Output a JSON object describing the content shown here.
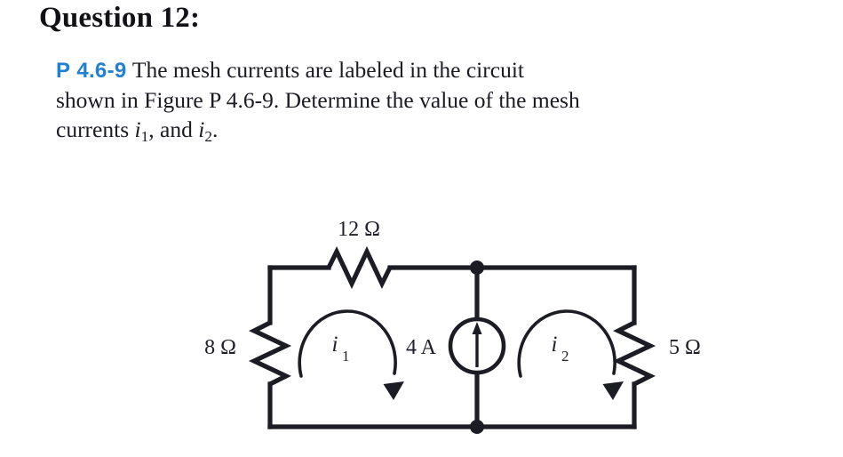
{
  "page": {
    "title": "Question 12:",
    "background_color": "#ffffff",
    "text_color": "#1b1b24"
  },
  "problem": {
    "id_prefix": "P",
    "id_number": "4.6-9",
    "id_color": "#1f81d0",
    "body_line1": "The mesh currents are labeled in the circuit",
    "body_line2": "shown in Figure P 4.6-9. Determine the value of the mesh",
    "body_line3_lead": "currents ",
    "body_line3_sym1": "i",
    "body_line3_sub1": "1",
    "body_line3_mid": ", and ",
    "body_line3_sym2": "i",
    "body_line3_sub2": "2",
    "body_line3_end": ".",
    "full_text": "P 4.6-9 The mesh currents are labeled in the circuit shown in Figure P 4.6-9. Determine the value of the mesh currents i1, and i2."
  },
  "circuit": {
    "caption_reference": "Figure P 4.6-9",
    "line_color": "#1c1c24",
    "components": [
      {
        "name": "resistor-12-ohm",
        "type": "resistor",
        "value": "12",
        "unit": "Ω",
        "label": "12 Ω",
        "orientation": "horizontal",
        "position": "top-branch"
      },
      {
        "name": "resistor-8-ohm",
        "type": "resistor",
        "value": "8",
        "unit": "Ω",
        "label": "8 Ω",
        "orientation": "vertical",
        "position": "left-branch"
      },
      {
        "name": "current-source-4a",
        "type": "current-source",
        "value": "4",
        "unit": "A",
        "label": "4 A",
        "direction": "up",
        "position": "center-branch"
      },
      {
        "name": "resistor-5-ohm",
        "type": "resistor",
        "value": "5",
        "unit": "Ω",
        "label": "5 Ω",
        "orientation": "vertical",
        "position": "right-branch"
      }
    ],
    "meshes": [
      {
        "name": "mesh-current-i1",
        "symbol": "i",
        "subscript": "1",
        "label": "i1",
        "direction": "clockwise",
        "position": "left-mesh"
      },
      {
        "name": "mesh-current-i2",
        "symbol": "i",
        "subscript": "2",
        "label": "i2",
        "direction": "clockwise",
        "position": "right-mesh"
      }
    ],
    "nodes": [
      {
        "name": "node-top-center",
        "label": ""
      },
      {
        "name": "node-bottom-center",
        "label": ""
      }
    ]
  }
}
